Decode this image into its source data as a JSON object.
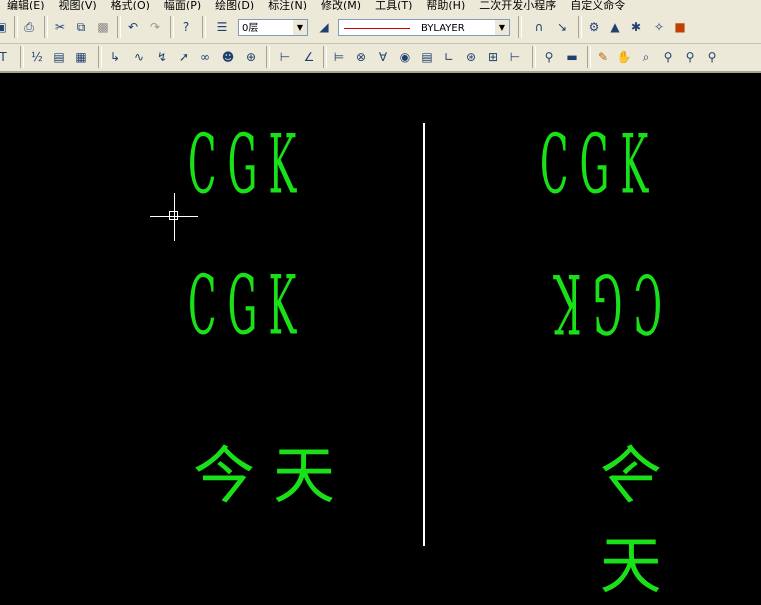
{
  "menu": {
    "items": [
      "编辑(E)",
      "视图(V)",
      "格式(O)",
      "幅面(P)",
      "绘图(D)",
      "标注(N)",
      "修改(M)",
      "工具(T)",
      "帮助(H)",
      "二次开发小程序",
      "自定义命令"
    ]
  },
  "toolbar": {
    "layer_combo": "0层",
    "linetype_combo": "BYLAYER",
    "linetype_color": "#CC0000"
  },
  "canvas": {
    "text_color": "#1AE01A",
    "left": {
      "line1": "CGK",
      "line2": "CGK",
      "line3": "今天"
    },
    "right": {
      "line1": "CGK",
      "line2": "CGK",
      "line3": "今天"
    }
  }
}
